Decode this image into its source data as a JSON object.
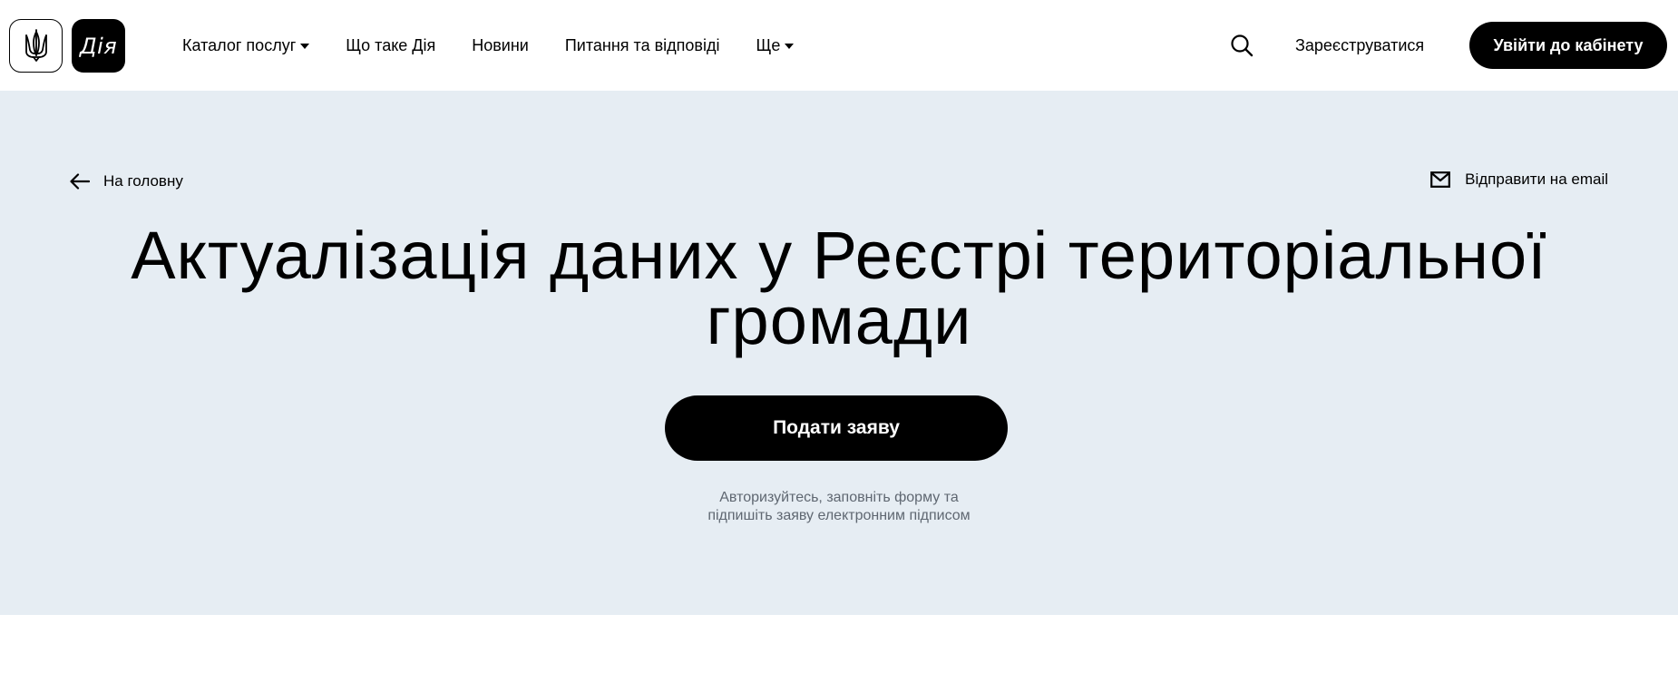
{
  "header": {
    "logo_diia_text": "Дія",
    "nav": [
      {
        "label": "Каталог послуг",
        "has_dropdown": true
      },
      {
        "label": "Що таке Дія",
        "has_dropdown": false
      },
      {
        "label": "Новини",
        "has_dropdown": false
      },
      {
        "label": "Питання та відповіді",
        "has_dropdown": false
      },
      {
        "label": "Ще",
        "has_dropdown": true
      }
    ],
    "search_icon": "search-icon",
    "register_label": "Зареєструватися",
    "login_label": "Увійти до кабінету"
  },
  "hero": {
    "back_label": "На головну",
    "email_label": "Відправити на email",
    "title_line1": "Актуалізація даних у Реєстрі територіальної",
    "title_line2": "громади",
    "submit_label": "Подати заяву",
    "hint_line1": "Авторизуйтесь, заповніть форму та",
    "hint_line2": "підпишіть заяву електронним підписом"
  },
  "colors": {
    "hero_background": "#e6edf3",
    "primary_button": "#000000",
    "hint_text": "#5f6771"
  }
}
